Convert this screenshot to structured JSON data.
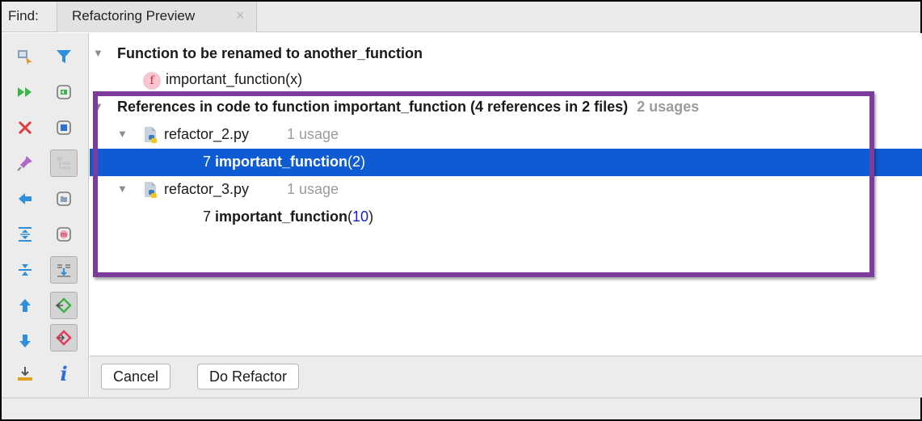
{
  "header": {
    "find_label": "Find:",
    "tab_label": "Refactoring Preview",
    "tab_close": "×"
  },
  "toolbar": {
    "more_glyph": "››",
    "info_glyph": "i"
  },
  "tree": {
    "group1": {
      "title": "Function to be renamed to another_function",
      "child_badge": "f",
      "child_label": "important_function(x)"
    },
    "group2": {
      "title": "References in code to function important_function (4 references in 2 files)",
      "count": "2 usages",
      "files": [
        {
          "name": "refactor_2.py",
          "usage": "1 usage",
          "line": "7",
          "func": "important_function",
          "args_open": "(",
          "arg": "2",
          "args_close": ")"
        },
        {
          "name": "refactor_3.py",
          "usage": "1 usage",
          "line": "7",
          "func": "important_function",
          "args_open": "(",
          "arg": "10",
          "args_close": ")"
        }
      ]
    }
  },
  "footer": {
    "cancel_label": "Cancel",
    "do_refactor_label": "Do Refactor"
  },
  "colors": {
    "selection": "#0f5bd4",
    "highlight_box": "#7b3c9c",
    "number_blue": "#1a1ad8"
  }
}
